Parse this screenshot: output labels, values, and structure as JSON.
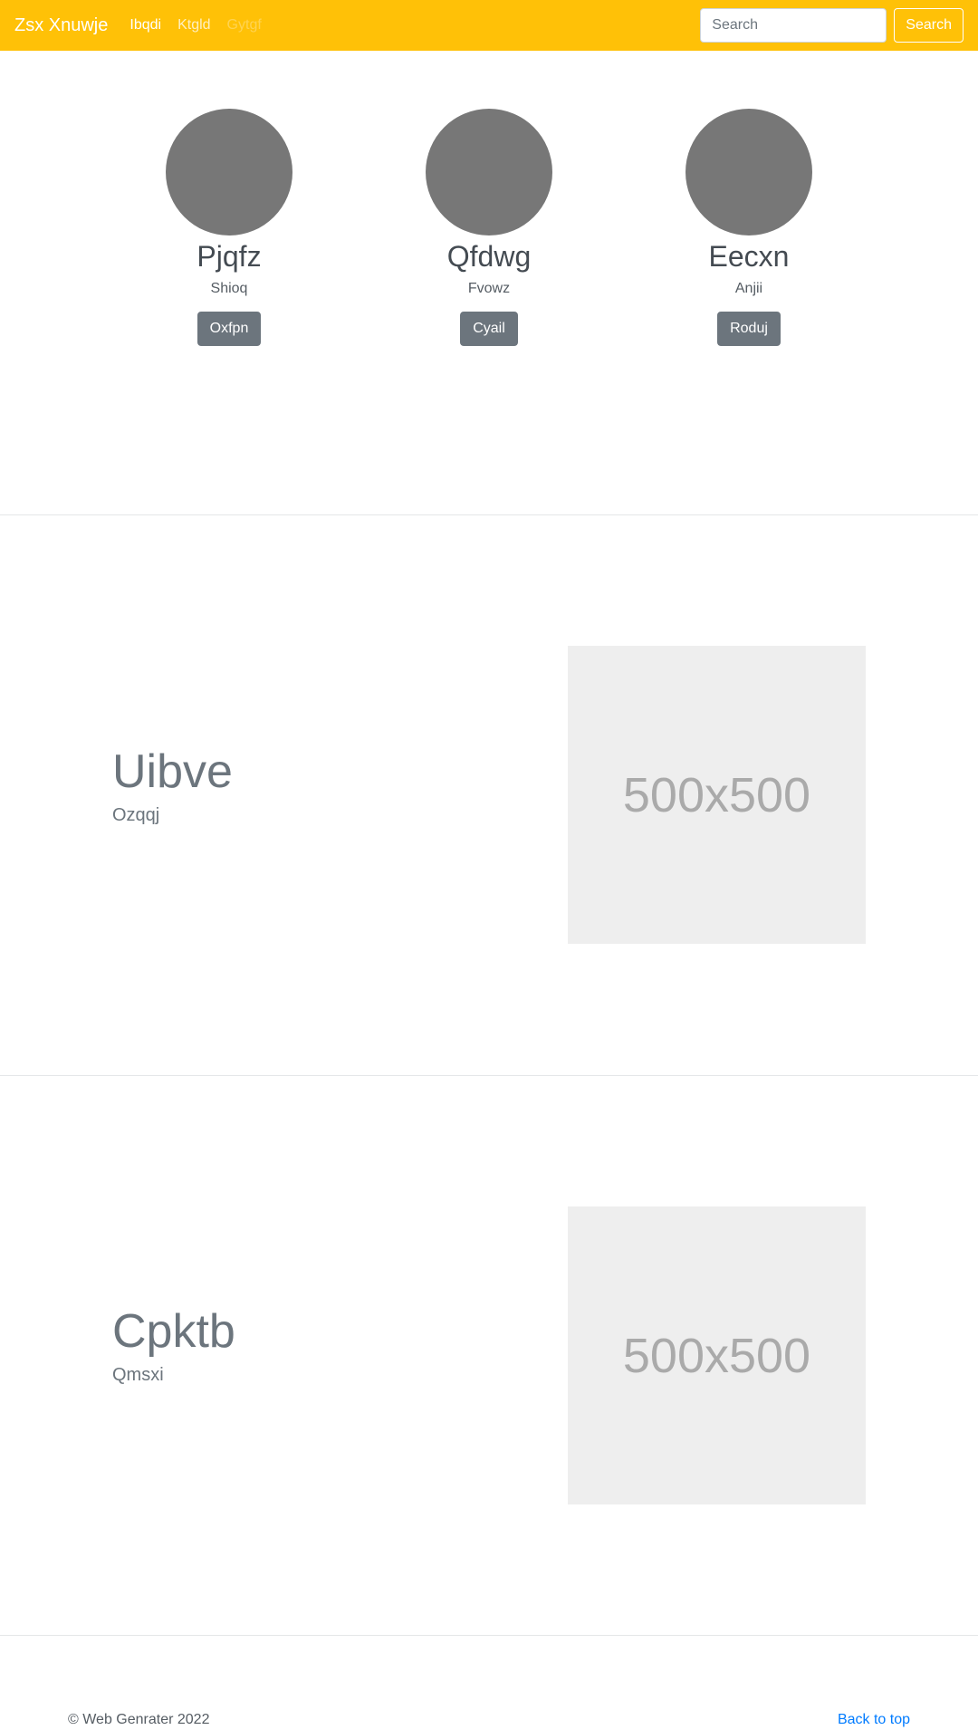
{
  "navbar": {
    "brand": "Zsx Xnuwje",
    "links": [
      {
        "label": "Ibqdi",
        "state": "active"
      },
      {
        "label": "Ktgld",
        "state": "normal"
      },
      {
        "label": "Gytgf",
        "state": "disabled"
      }
    ],
    "search": {
      "placeholder": "Search",
      "button_label": "Search"
    },
    "background": "#ffc107"
  },
  "team": {
    "members": [
      {
        "name": "Pjqfz",
        "role": "Shioq",
        "button_label": "Oxfpn"
      },
      {
        "name": "Qfdwg",
        "role": "Fvowz",
        "button_label": "Cyail"
      },
      {
        "name": "Eecxn",
        "role": "Anjii",
        "button_label": "Roduj"
      }
    ]
  },
  "features": [
    {
      "heading": "Uibve",
      "subheading": "Ozqqj",
      "image_label": "500x500"
    },
    {
      "heading": "Cpktb",
      "subheading": "Qmsxi",
      "image_label": "500x500"
    }
  ],
  "footer": {
    "copyright": "© Web Genrater 2022",
    "back_to_top": "Back to top"
  }
}
